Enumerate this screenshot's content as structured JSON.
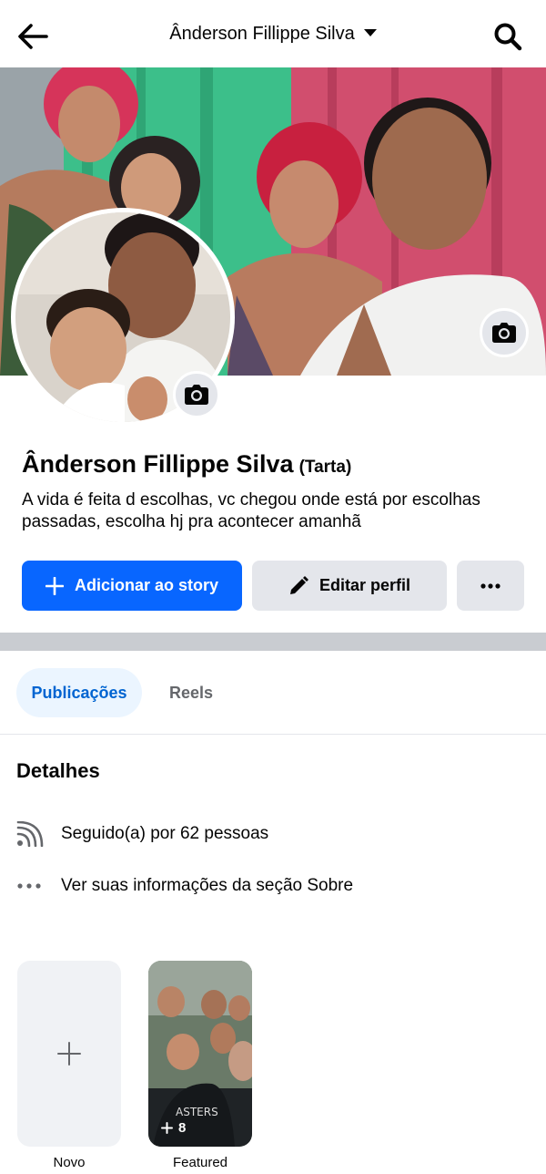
{
  "header": {
    "title": "Ânderson Fillippe Silva",
    "back_icon": "arrow-left-icon",
    "search_icon": "search-icon"
  },
  "profile": {
    "name": "Ânderson Fillippe Silva",
    "nickname": "(Tarta)",
    "bio": "A vida é feita d escolhas, vc chegou onde está por escolhas passadas, escolha hj pra acontecer amanhã"
  },
  "actions": {
    "add_story": "Adicionar ao story",
    "edit_profile": "Editar perfil"
  },
  "tabs": [
    {
      "label": "Publicações",
      "active": true
    },
    {
      "label": "Reels",
      "active": false
    }
  ],
  "details": {
    "title": "Detalhes",
    "items": [
      {
        "icon": "rss-feed-icon",
        "text": "Seguido(a) por 62 pessoas"
      },
      {
        "icon": "more-dots-icon",
        "text": "Ver suas informações da seção Sobre"
      }
    ]
  },
  "highlights": [
    {
      "label": "Novo",
      "type": "new"
    },
    {
      "label": "Featured",
      "count": "8"
    }
  ],
  "colors": {
    "primary": "#0866ff",
    "button_gray": "#e4e6eb",
    "tab_active_bg": "#ebf5ff",
    "tab_active_text": "#0064d1"
  }
}
